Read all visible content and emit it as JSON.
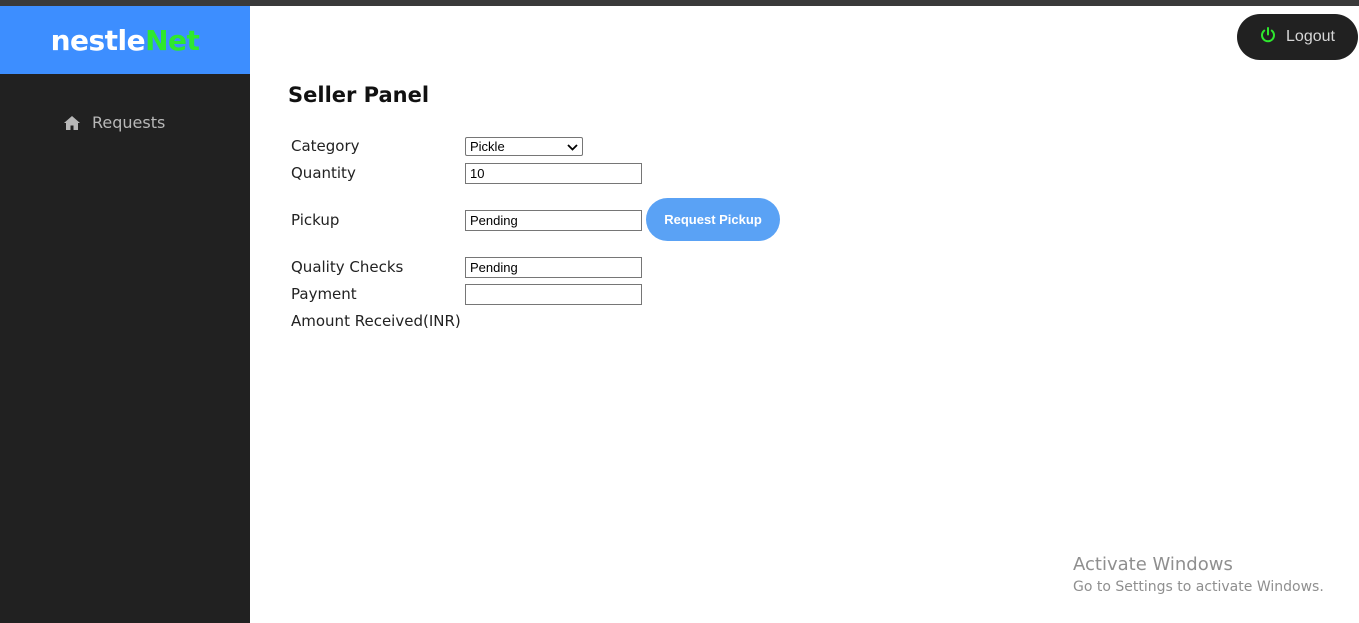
{
  "brand": {
    "part1": "nestle",
    "part2": "Net"
  },
  "sidebar": {
    "items": [
      {
        "label": "Requests",
        "icon": "home-icon"
      }
    ]
  },
  "header": {
    "logout_label": "Logout",
    "logout_icon": "power-icon"
  },
  "panel": {
    "title": "Seller Panel",
    "category": {
      "label": "Category",
      "selected": "Pickle"
    },
    "quantity": {
      "label": "Quantity",
      "value": "10"
    },
    "pickup": {
      "label": "Pickup",
      "value": "Pending",
      "button_label": "Request Pickup"
    },
    "quality": {
      "label": "Quality Checks",
      "value": "Pending"
    },
    "payment": {
      "label": "Payment",
      "value": ""
    },
    "amount": {
      "label": "Amount Received(INR)"
    }
  },
  "watermark": {
    "title": "Activate Windows",
    "subtitle": "Go to Settings to activate Windows."
  },
  "colors": {
    "brand_bar": "#3d8eff",
    "brand_accent": "#2ee82e",
    "sidebar": "#212121",
    "button": "#5aa2f5"
  }
}
